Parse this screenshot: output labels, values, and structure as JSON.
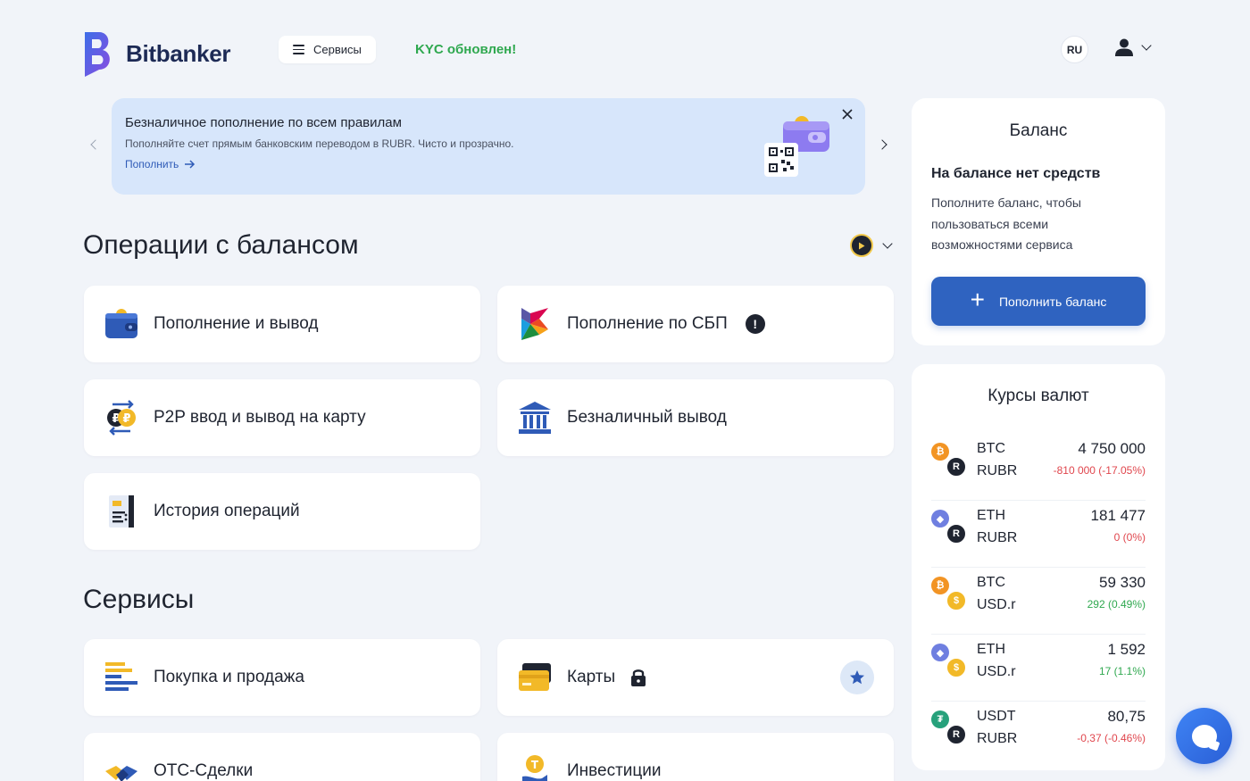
{
  "header": {
    "brand": "Bitbanker",
    "services_label": "Сервисы",
    "kyc_status": "KYC обновлен!",
    "lang": "RU"
  },
  "banner": {
    "title": "Безналичное пополнение по всем правилам",
    "subtitle": "Пополняйте счет прямым банковским переводом в RUBR. Чисто и прозрачно.",
    "link": "Пополнить"
  },
  "operations": {
    "title": "Операции с балансом",
    "items": [
      {
        "label": "Пополнение и вывод",
        "icon": "wallet-icon"
      },
      {
        "label": "Пополнение по СБП",
        "icon": "sbp-icon"
      },
      {
        "label": "P2P ввод и вывод на карту",
        "icon": "p2p-exchange-icon"
      },
      {
        "label": "Безналичный вывод",
        "icon": "bank-icon"
      },
      {
        "label": "История операций",
        "icon": "document-icon"
      }
    ]
  },
  "services": {
    "title": "Сервисы",
    "items": [
      {
        "label": "Покупка и продажа",
        "icon": "bars-icon"
      },
      {
        "label": "Карты",
        "icon": "cards-icon"
      },
      {
        "label": "OTC-Сделки",
        "icon": "handshake-icon"
      },
      {
        "label": "Инвестиции",
        "icon": "investments-icon"
      }
    ]
  },
  "balance": {
    "title": "Баланс",
    "empty_title": "На балансе нет средств",
    "empty_desc": "Пополните баланс, чтобы пользоваться всеми возможностями сервиса",
    "topup_label": "Пополнить баланс"
  },
  "rates": {
    "title": "Курсы валют",
    "items": [
      {
        "base": "BTC",
        "quote": "RUBR",
        "rate": "4 750 000",
        "change": "-810 000 (-17.05%)",
        "trend": "neg"
      },
      {
        "base": "ETH",
        "quote": "RUBR",
        "rate": "181 477",
        "change": "0 (0%)",
        "trend": "neg"
      },
      {
        "base": "BTC",
        "quote": "USD.r",
        "rate": "59 330",
        "change": "292 (0.49%)",
        "trend": "pos"
      },
      {
        "base": "ETH",
        "quote": "USD.r",
        "rate": "1 592",
        "change": "17 (1.1%)",
        "trend": "pos"
      },
      {
        "base": "USDT",
        "quote": "RUBR",
        "rate": "80,75",
        "change": "-0,37 (-0.46%)",
        "trend": "neg"
      }
    ]
  },
  "colors": {
    "accent": "#2f63c0",
    "kyc": "#2fa84f",
    "negative": "#e0464d",
    "positive": "#2fa84f"
  }
}
